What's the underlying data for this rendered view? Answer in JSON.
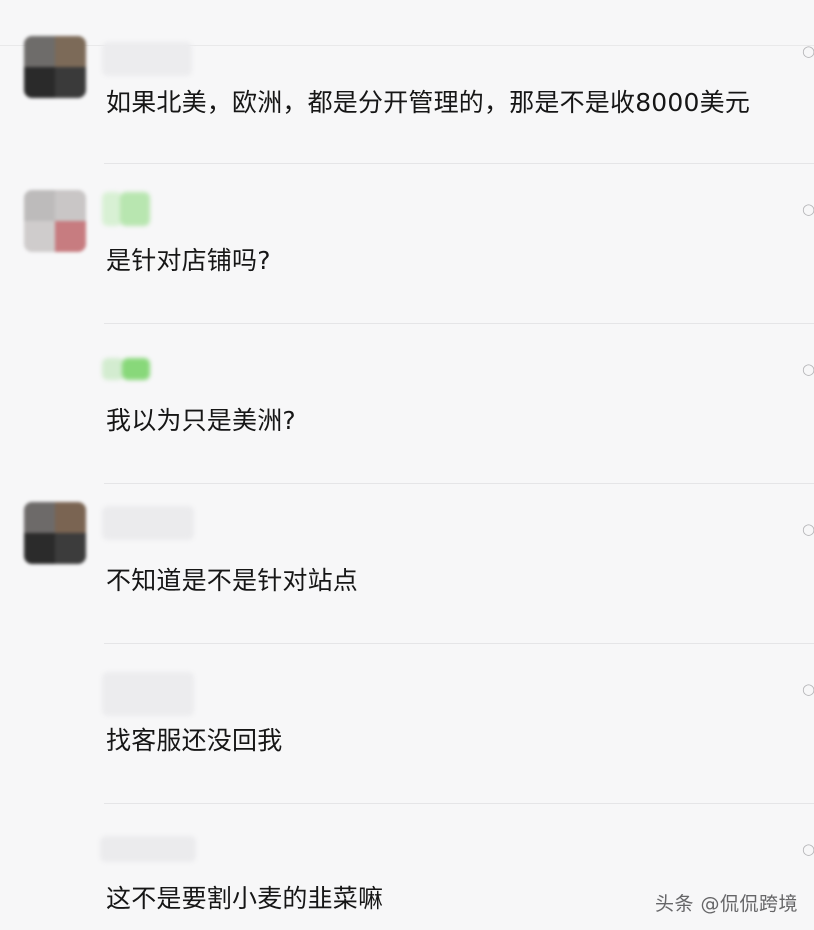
{
  "messages": [
    {
      "text": "如果北美，欧洲，都是分开管理的，那是不是收8000美元"
    },
    {
      "text": "是针对店铺吗?"
    },
    {
      "text": "我以为只是美洲?"
    },
    {
      "text": "不知道是不是针对站点"
    },
    {
      "text": "找客服还没回我"
    },
    {
      "text": "这不是要割小麦的韭菜嘛"
    }
  ],
  "watermark": "头条 @侃侃跨境",
  "colors": {
    "background": "#f7f7f8",
    "text": "#161616",
    "divider": "#e5e5e7",
    "name_blur_green": "#7fd07a"
  }
}
